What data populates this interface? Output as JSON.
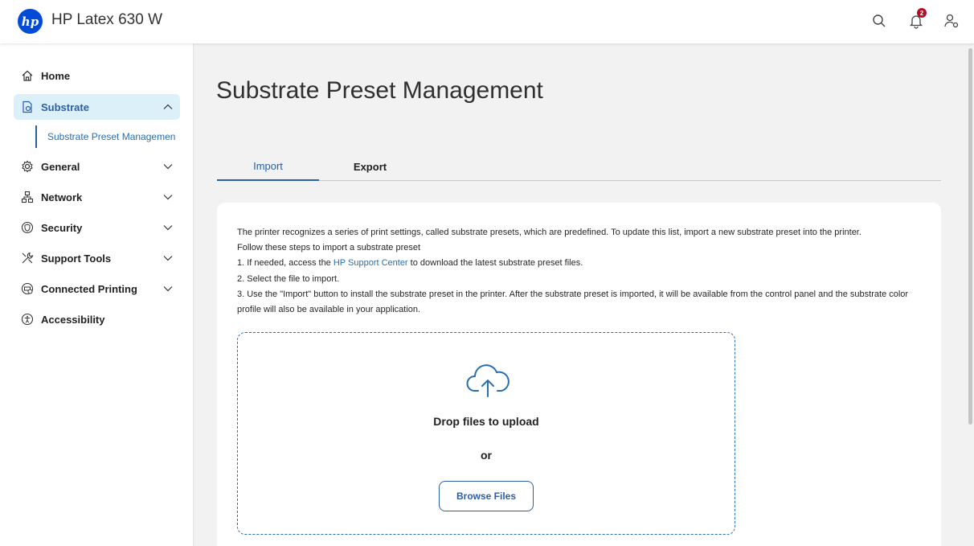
{
  "header": {
    "logo_text": "hp",
    "app_title": "HP Latex 630 W",
    "notifications_count": "2",
    "icons": [
      "search-icon",
      "bell-icon",
      "user-settings-icon"
    ]
  },
  "sidebar": {
    "items": [
      {
        "label": "Home",
        "icon": "home-icon"
      },
      {
        "label": "Substrate",
        "icon": "substrate-icon",
        "expanded": true
      },
      {
        "label": "General",
        "icon": "gear-icon"
      },
      {
        "label": "Network",
        "icon": "network-icon"
      },
      {
        "label": "Security",
        "icon": "shield-icon"
      },
      {
        "label": "Support Tools",
        "icon": "tools-icon"
      },
      {
        "label": "Connected Printing",
        "icon": "connected-printing-icon"
      },
      {
        "label": "Accessibility",
        "icon": "accessibility-icon"
      }
    ],
    "subitem_label": "Substrate Preset Managemen"
  },
  "main": {
    "page_title": "Substrate Preset Management",
    "tabs": [
      {
        "label": "Import",
        "active": true
      },
      {
        "label": "Export",
        "active": false
      }
    ],
    "description": {
      "line1": "The printer recognizes a series of print settings, called substrate presets, which are predefined. To update this list, import a new substrate preset into the printer.",
      "line2": "Follow these steps to import a substrate preset",
      "step1_pre": "1. If needed, access the ",
      "step1_link": "HP Support Center",
      "step1_post": " to download the latest substrate preset files.",
      "step2": "2. Select the file to import.",
      "step3": "3. Use the \"Import\" button to install the substrate preset in the printer. After the substrate preset is imported, it will be available from the control panel and the substrate color profile will also be available in your application."
    },
    "dropzone": {
      "drop_label": "Drop files to upload",
      "or_label": "or",
      "browse_label": "Browse Files"
    }
  },
  "colors": {
    "accent": "#2a5fa5",
    "link": "#2a6eb0",
    "active_nav_bg": "#dcf0f9",
    "badge": "#b30d26",
    "logo": "#024ad8"
  }
}
